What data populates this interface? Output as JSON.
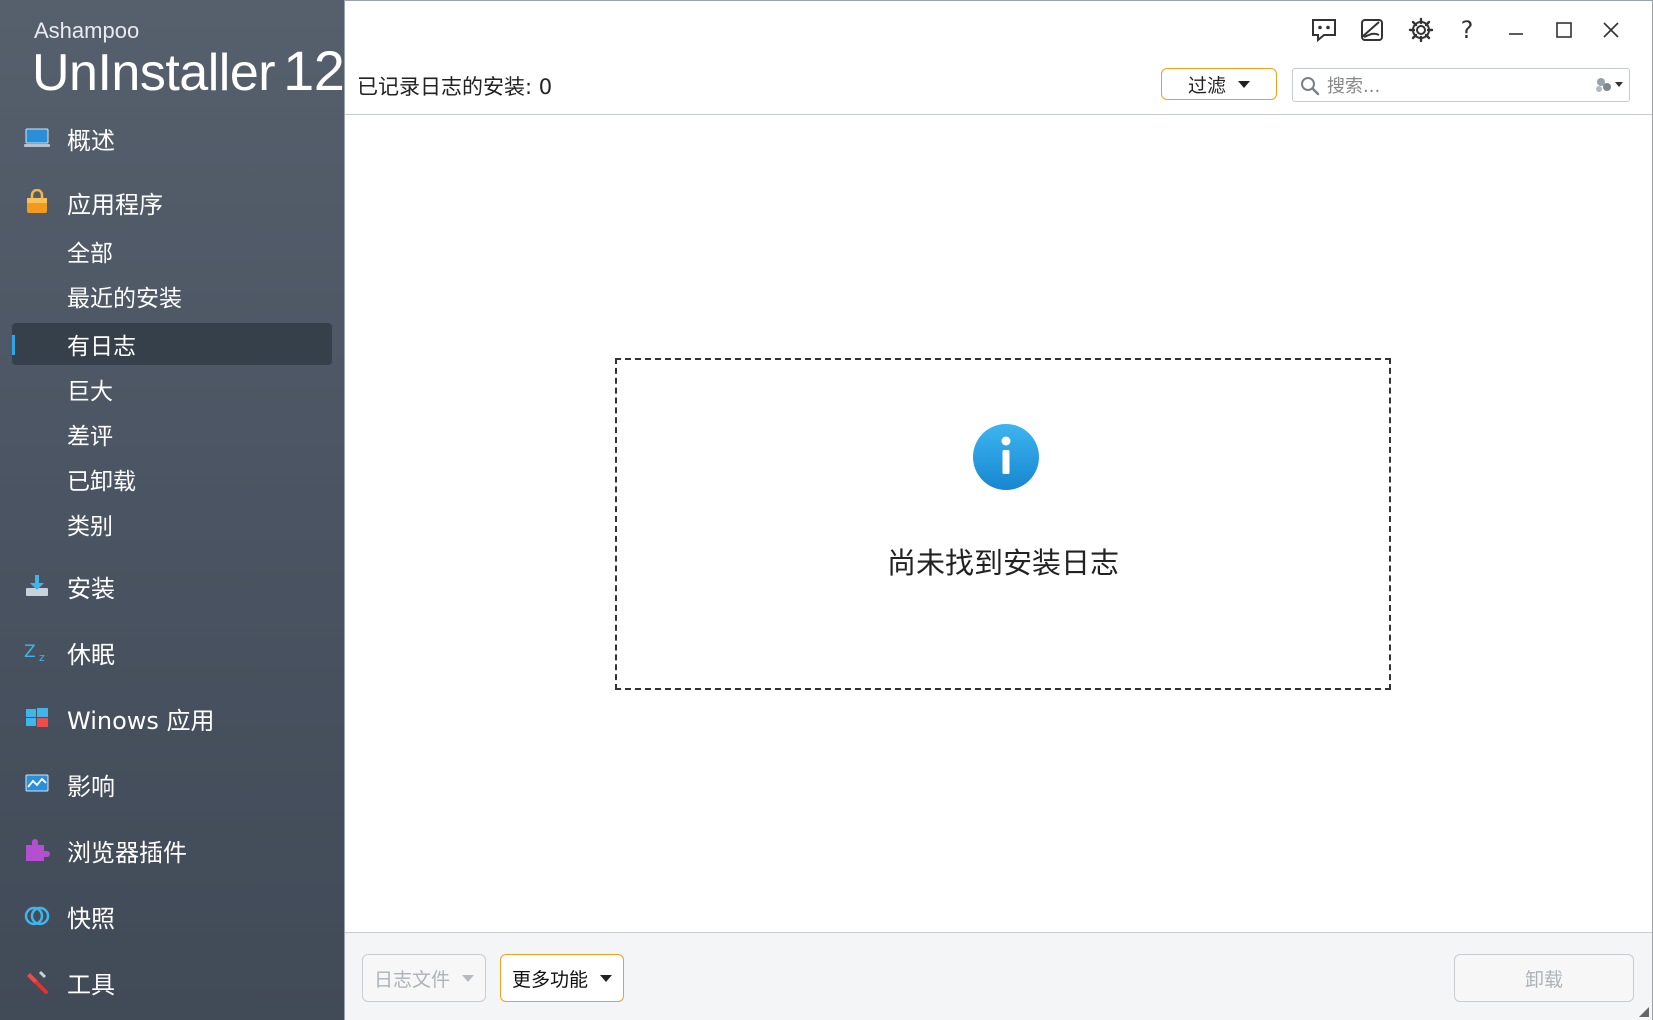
{
  "brand": {
    "maker": "Ashampoo",
    "product": "UnInstaller",
    "version": "12"
  },
  "sidebar": {
    "overview": "概述",
    "applications": "应用程序",
    "sub_items": [
      "全部",
      "最近的安装",
      "有日志",
      "巨大",
      "差评",
      "已卸载",
      "类别"
    ],
    "active_sub": "有日志",
    "install": "安装",
    "hibernate": "休眠",
    "windows_apps": "Winows 应用",
    "impact": "影响",
    "browser_plugins": "浏览器插件",
    "snapshots": "快照",
    "tools": "工具"
  },
  "header": {
    "count_label": "已记录日志的安装: 0",
    "filter_label": "过滤",
    "search_placeholder": "搜索..."
  },
  "empty_state": {
    "message": "尚未找到安装日志"
  },
  "footer": {
    "logfile_label": "日志文件",
    "more_label": "更多功能",
    "uninstall_label": "卸载"
  },
  "colors": {
    "accent": "#f0a020",
    "info_blue": "#1e9be0",
    "sidebar_bg": "#4a5462"
  },
  "icons": [
    "feedback-icon",
    "skin-icon",
    "gear-icon",
    "help-icon",
    "minimize-icon",
    "maximize-icon",
    "close-icon",
    "search-icon",
    "search-options-icon",
    "info-icon"
  ]
}
